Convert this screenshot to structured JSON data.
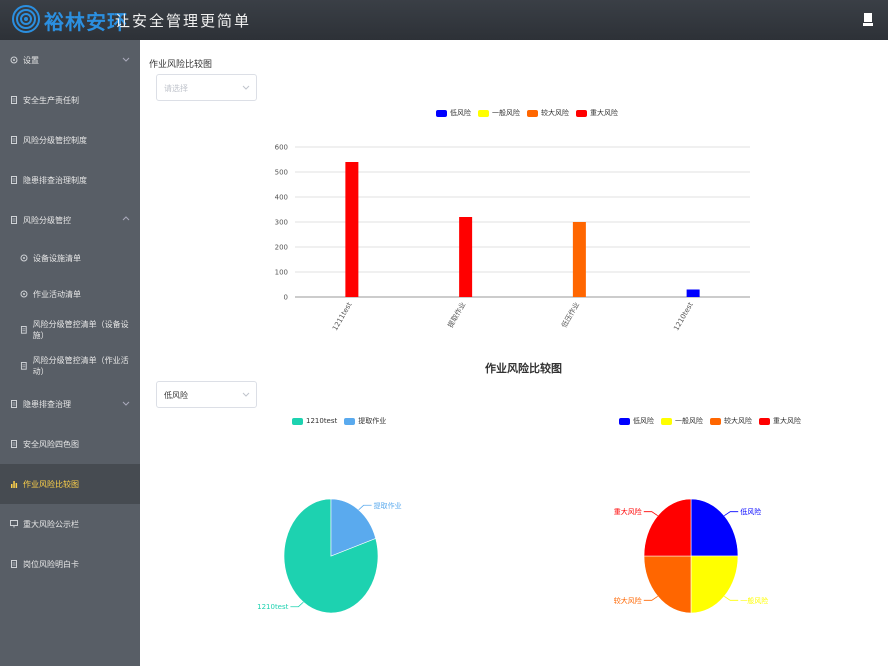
{
  "header": {
    "logo_text": "裕林安环",
    "slogan": "让安全管理更简单"
  },
  "sidebar": {
    "items": [
      {
        "label": "设置",
        "icon": "gear-icon",
        "expandable": true
      },
      {
        "label": "安全生产责任制",
        "icon": "document-icon"
      },
      {
        "label": "风险分级管控制度",
        "icon": "document-icon"
      },
      {
        "label": "隐患排查治理制度",
        "icon": "document-icon"
      },
      {
        "label": "风险分级管控",
        "icon": "document-icon",
        "expandable": true,
        "expanded": true
      },
      {
        "label": "设备设施清单",
        "icon": "gear-icon",
        "sub": true
      },
      {
        "label": "作业活动清单",
        "icon": "gear-icon",
        "sub": true
      },
      {
        "label": "风险分级管控清单（设备设施）",
        "icon": "document-icon",
        "sub": true
      },
      {
        "label": "风险分级管控清单（作业活动）",
        "icon": "document-icon",
        "sub": true
      },
      {
        "label": "隐患排查治理",
        "icon": "document-icon",
        "expandable": true
      },
      {
        "label": "安全风险四色图",
        "icon": "document-icon"
      },
      {
        "label": "作业风险比较图",
        "icon": "bar-chart-icon",
        "active": true
      },
      {
        "label": "重大风险公示栏",
        "icon": "monitor-icon"
      },
      {
        "label": "岗位风险明白卡",
        "icon": "document-icon"
      }
    ]
  },
  "main": {
    "section_title": "作业风险比较图",
    "select1_placeholder": "请选择",
    "chart2_title": "作业风险比较图",
    "select2_value": "低风险"
  },
  "colors": {
    "low": "#0000ff",
    "normal": "#ffff00",
    "larger": "#ff6600",
    "major": "#ff0000",
    "teal": "#1dd2b0",
    "lightblue": "#5aaaee"
  },
  "chart_data": [
    {
      "type": "bar",
      "legend": [
        "低风险",
        "一般风险",
        "较大风险",
        "重大风险"
      ],
      "legend_placement": "top-center",
      "categories": [
        "1211test",
        "提取作业",
        "低压作业",
        "1210test"
      ],
      "bars": [
        {
          "category": "1211test",
          "series": "重大风险",
          "value": 540
        },
        {
          "category": "提取作业",
          "series": "重大风险",
          "value": 320
        },
        {
          "category": "低压作业",
          "series": "较大风险",
          "value": 300
        },
        {
          "category": "1210test",
          "series": "低风险",
          "value": 30
        }
      ],
      "yticks": [
        "0",
        "100",
        "200",
        "300",
        "400",
        "500",
        "600"
      ],
      "ylim": [
        0,
        600
      ],
      "grid": true
    },
    {
      "type": "pie",
      "legend": [
        "1210test",
        "提取作业"
      ],
      "legend_placement": "top-center",
      "slices": [
        {
          "label": "1210test",
          "value": 80
        },
        {
          "label": "提取作业",
          "value": 20
        }
      ]
    },
    {
      "type": "pie",
      "legend": [
        "低风险",
        "一般风险",
        "较大风险",
        "重大风险"
      ],
      "legend_placement": "top-center",
      "slices": [
        {
          "label": "低风险",
          "value": 25
        },
        {
          "label": "一般风险",
          "value": 25
        },
        {
          "label": "较大风险",
          "value": 25
        },
        {
          "label": "重大风险",
          "value": 25
        }
      ]
    }
  ]
}
